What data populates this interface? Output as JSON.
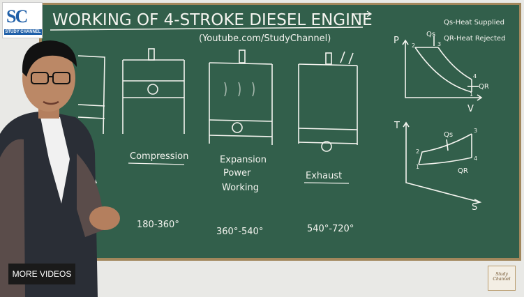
{
  "board": {
    "title": "WORKING OF 4-STROKE DIESEL ENGINE",
    "subtitle": "(Youtube.com/StudyChannel)",
    "legend_qs": "Qs-Heat Supplied",
    "legend_qr": "QR-Heat Rejected",
    "strokes": [
      {
        "label": "Compression",
        "angle": "180-360°"
      },
      {
        "label_lines": [
          "Expansion",
          "Power",
          "Working"
        ],
        "angle": "360°-540°"
      },
      {
        "label": "Exhaust",
        "angle": "540°-720°"
      }
    ],
    "pv_diagram": {
      "y_axis": "P",
      "x_axis": "V",
      "heat_in": "Qs",
      "heat_out": "QR",
      "points": [
        "2",
        "3",
        "4",
        "1"
      ]
    },
    "ts_diagram": {
      "y_axis": "T",
      "x_axis": "S",
      "heat_in": "Qs",
      "heat_out": "QR",
      "points": [
        "1",
        "2",
        "3",
        "4"
      ]
    }
  },
  "logo": {
    "letters": "SC",
    "tagline": "STUDY CHANNEL"
  },
  "overlay": {
    "more_videos": "MORE VIDEOS",
    "watermark": "Study Channel"
  },
  "colors": {
    "board": "#2f5b48",
    "frame": "#a2875c",
    "chalk": "#f4f4ef",
    "wall": "#e9e9e6"
  }
}
